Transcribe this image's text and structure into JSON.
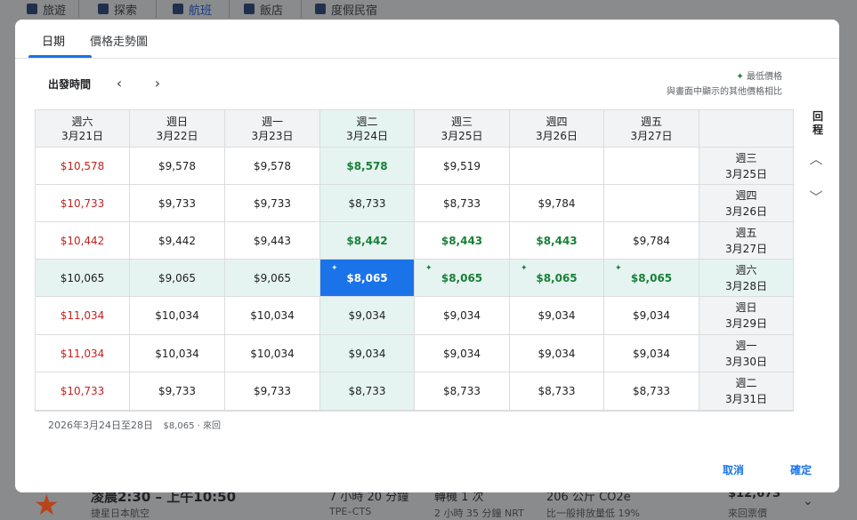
{
  "background": {
    "nav_tabs": [
      {
        "label": "旅遊",
        "icon": "suitcase-icon"
      },
      {
        "label": "探索",
        "icon": "explore-icon"
      },
      {
        "label": "航班",
        "icon": "flight-icon"
      },
      {
        "label": "飯店",
        "icon": "hotel-icon"
      },
      {
        "label": "度假民宿",
        "icon": "house-icon"
      }
    ],
    "result": {
      "time": "凌晨2:30 – 上午10:50",
      "airline": "捷星日本航空",
      "duration": "7 小時 20 分鐘",
      "route": "TPE–CTS",
      "stops": "轉機 1 次",
      "layover": "2 小時 35 分鐘 NRT",
      "emissions": "206 公斤 CO2e",
      "emissions_note": "比一般排放量低 19%",
      "price": "$12,673",
      "trip_type": "來回票價"
    }
  },
  "modal": {
    "tabs": [
      "日期",
      "價格走勢圖"
    ],
    "active_tab": 0,
    "departure_label": "出發時間",
    "legend_lowest": "最低價格",
    "legend_compare": "與畫面中顯示的其他價格相比",
    "return_label": "回程",
    "columns": [
      {
        "day": "週六",
        "date": "3月21日"
      },
      {
        "day": "週日",
        "date": "3月22日"
      },
      {
        "day": "週一",
        "date": "3月23日"
      },
      {
        "day": "週二",
        "date": "3月24日"
      },
      {
        "day": "週三",
        "date": "3月25日"
      },
      {
        "day": "週四",
        "date": "3月26日"
      },
      {
        "day": "週五",
        "date": "3月27日"
      }
    ],
    "rows": [
      {
        "day": "週三",
        "date": "3月25日",
        "prices": [
          "$10,578",
          "$9,578",
          "$9,578",
          "$8,578",
          "$9,519",
          "",
          ""
        ]
      },
      {
        "day": "週四",
        "date": "3月26日",
        "prices": [
          "$10,733",
          "$9,733",
          "$9,733",
          "$8,733",
          "$8,733",
          "$9,784",
          ""
        ]
      },
      {
        "day": "週五",
        "date": "3月27日",
        "prices": [
          "$10,442",
          "$9,442",
          "$9,443",
          "$8,442",
          "$8,443",
          "$8,443",
          "$9,784"
        ]
      },
      {
        "day": "週六",
        "date": "3月28日",
        "prices": [
          "$10,065",
          "$9,065",
          "$9,065",
          "$8,065",
          "$8,065",
          "$8,065",
          "$8,065"
        ]
      },
      {
        "day": "週日",
        "date": "3月29日",
        "prices": [
          "$11,034",
          "$10,034",
          "$10,034",
          "$9,034",
          "$9,034",
          "$9,034",
          "$9,034"
        ]
      },
      {
        "day": "週一",
        "date": "3月30日",
        "prices": [
          "$11,034",
          "$10,034",
          "$10,034",
          "$9,034",
          "$9,034",
          "$9,034",
          "$9,034"
        ]
      },
      {
        "day": "週二",
        "date": "3月31日",
        "prices": [
          "$10,733",
          "$9,733",
          "$9,733",
          "$8,733",
          "$8,733",
          "$8,733",
          "$8,733"
        ]
      }
    ],
    "price_colors": {
      "high": "#c5221f",
      "low": "#188038",
      "selected_bg": "#1a73e8",
      "highlight_bg": "#e6f4f1"
    },
    "selected": {
      "row": 3,
      "col": 3
    },
    "high_cells": [
      [
        0,
        0
      ],
      [
        1,
        0
      ],
      [
        2,
        0
      ],
      [
        4,
        0
      ],
      [
        5,
        0
      ],
      [
        6,
        0
      ]
    ],
    "low_cells": [
      [
        0,
        3
      ],
      [
        2,
        3
      ],
      [
        2,
        4
      ],
      [
        2,
        5
      ],
      [
        3,
        4
      ],
      [
        3,
        5
      ],
      [
        3,
        6
      ]
    ],
    "lowest_cells": [
      [
        3,
        3
      ],
      [
        3,
        4
      ],
      [
        3,
        5
      ],
      [
        3,
        6
      ]
    ],
    "summary_dates": "2026年3月24日至28日",
    "summary_price": "$8,065 · 來回",
    "cancel_label": "取消",
    "confirm_label": "確定"
  }
}
